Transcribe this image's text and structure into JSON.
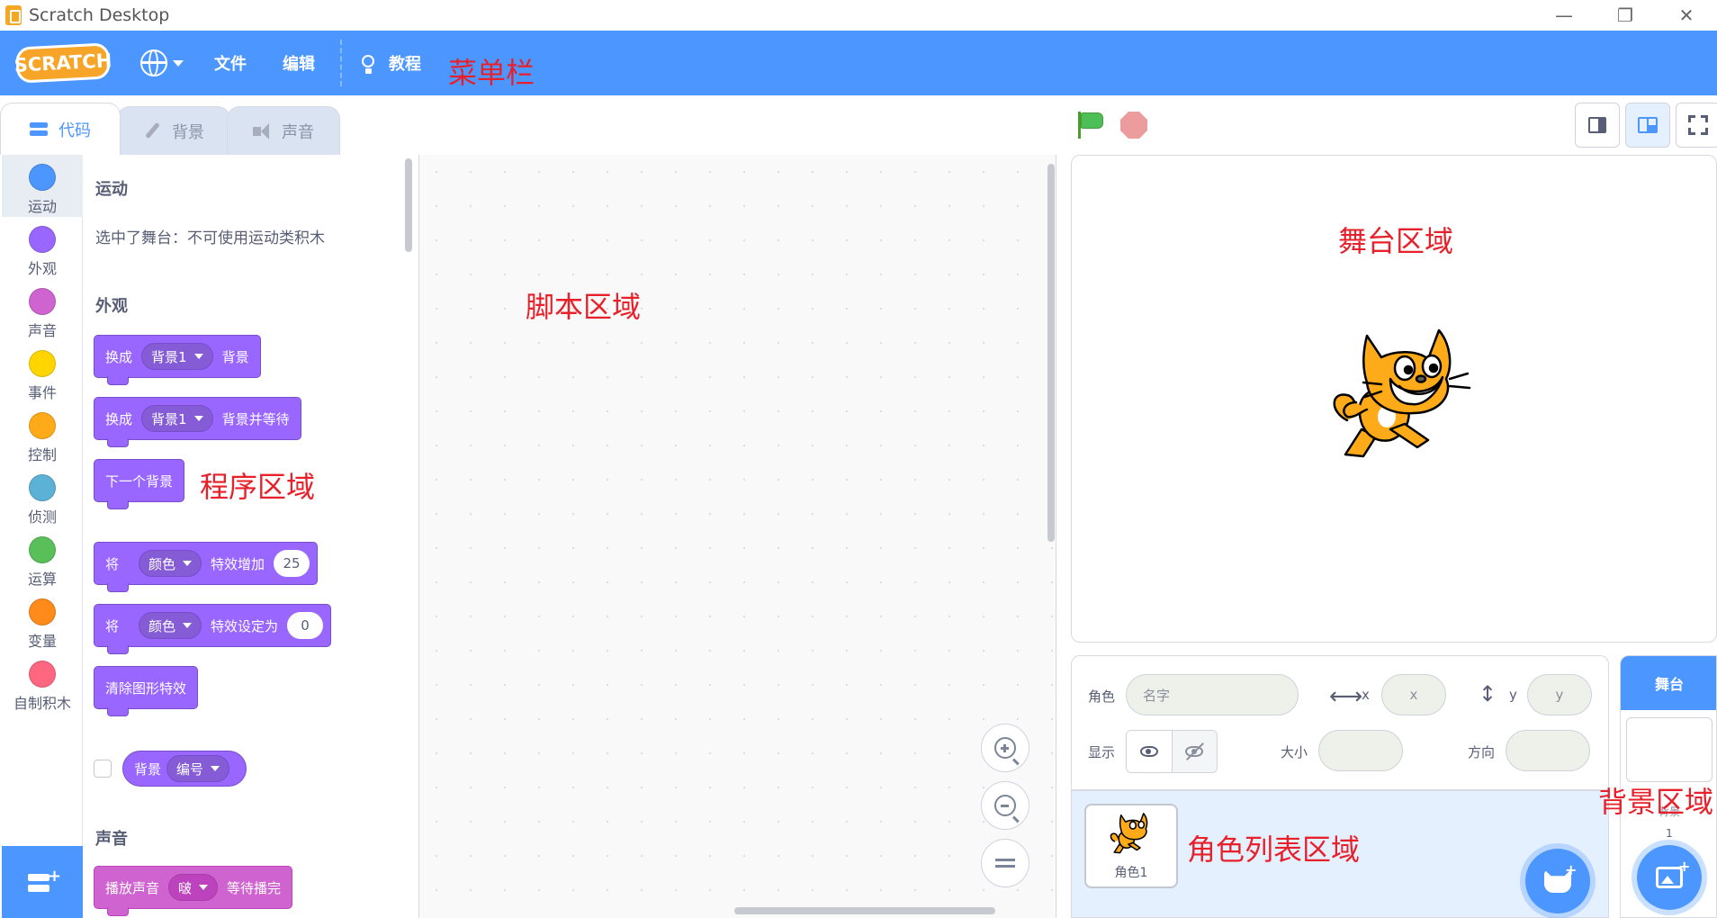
{
  "window": {
    "title": "Scratch Desktop",
    "minimize": "—",
    "restore": "❐",
    "close": "✕"
  },
  "menubar": {
    "logo": "SCRATCH",
    "file": "文件",
    "edit": "编辑",
    "tutorials": "教程",
    "annotation": "菜单栏"
  },
  "tabs": {
    "code": "代码",
    "backdrops": "背景",
    "sounds": "声音"
  },
  "categories": [
    {
      "label": "运动",
      "color": "#4c97ff"
    },
    {
      "label": "外观",
      "color": "#9966ff"
    },
    {
      "label": "声音",
      "color": "#cf63cf"
    },
    {
      "label": "事件",
      "color": "#ffd500"
    },
    {
      "label": "控制",
      "color": "#ffab19"
    },
    {
      "label": "侦测",
      "color": "#5cb1d6"
    },
    {
      "label": "运算",
      "color": "#59c059"
    },
    {
      "label": "变量",
      "color": "#ff8c1a"
    },
    {
      "label": "自制积木",
      "color": "#ff6680"
    }
  ],
  "palette": {
    "motion_title": "运动",
    "motion_note": "选中了舞台：不可使用运动类积木",
    "looks_title": "外观",
    "block1": {
      "a": "换成",
      "dd": "背景1",
      "b": "背景"
    },
    "block2": {
      "a": "换成",
      "dd": "背景1",
      "b": "背景并等待"
    },
    "block3": {
      "a": "下一个背景"
    },
    "block4": {
      "a": "将",
      "dd": "颜色",
      "b": "特效增加",
      "num": "25"
    },
    "block5": {
      "a": "将",
      "dd": "颜色",
      "b": "特效设定为",
      "num": "0"
    },
    "block6": {
      "a": "清除图形特效"
    },
    "reporter": {
      "a": "背景",
      "dd": "编号"
    },
    "sound_title": "声音",
    "block7": {
      "a": "播放声音",
      "dd": "啵",
      "b": "等待播完"
    },
    "annotation": "程序区域"
  },
  "script_area": {
    "annotation": "脚本区域"
  },
  "stage": {
    "annotation": "舞台区域"
  },
  "sprite_info": {
    "sprite_label": "角色",
    "name_placeholder": "名字",
    "x_label": "x",
    "x_placeholder": "x",
    "y_label": "y",
    "y_placeholder": "y",
    "show_label": "显示",
    "size_label": "大小",
    "direction_label": "方向"
  },
  "sprite_list": {
    "sprite_name": "角色1",
    "annotation": "角色列表区域"
  },
  "stage_pane": {
    "title": "舞台",
    "backdrops_label": "背景",
    "backdrops_count": "1",
    "annotation": "背景区域"
  }
}
